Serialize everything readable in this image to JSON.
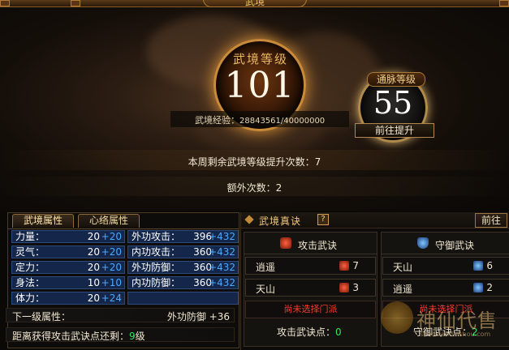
{
  "window": {
    "title": "武境"
  },
  "upper": {
    "main_orb": {
      "label": "武境等级",
      "value": "101"
    },
    "side_orb": {
      "label": "通脉等级",
      "value": "55"
    },
    "experience": {
      "label": "武境经验：",
      "value": "28843561/40000000"
    },
    "upgrade_button": "前往提升",
    "weekly_remaining": "本周剩余武境等级提升次数：7",
    "extra_count": "额外次数：2"
  },
  "left_panel": {
    "tabs": [
      {
        "label": "武境属性",
        "active": true
      },
      {
        "label": "心络属性",
        "active": false
      }
    ],
    "attributes": [
      {
        "label": "力量：",
        "base": "20",
        "bonus": "+20",
        "label2": "外功攻击：",
        "base2": "396",
        "bonus2": "+432"
      },
      {
        "label": "灵气：",
        "base": "20",
        "bonus": "+20",
        "label2": "内功攻击：",
        "base2": "360",
        "bonus2": "+432"
      },
      {
        "label": "定力：",
        "base": "20",
        "bonus": "+20",
        "label2": "外功防御：",
        "base2": "360",
        "bonus2": "+432"
      },
      {
        "label": "身法：",
        "base": "10",
        "bonus": "+10",
        "label2": "内功防御：",
        "base2": "360",
        "bonus2": "+432"
      },
      {
        "label": "体力：",
        "base": "20",
        "bonus": "+24",
        "label2": "",
        "base2": "",
        "bonus2": ""
      }
    ],
    "next_level": {
      "label": "下一级属性：",
      "value": "外功防御 +36"
    },
    "distance": {
      "prefix": "距离获得攻击武诀点还剩：",
      "value": "9",
      "suffix": "级"
    }
  },
  "right_panel": {
    "title": "武境真诀",
    "help": "?",
    "goto_button": "前往",
    "attack": {
      "title": "攻击武诀",
      "entries": [
        {
          "name": "逍遥",
          "value": "7"
        },
        {
          "name": "天山",
          "value": "3"
        }
      ],
      "notice": "尚未选择门派",
      "points_label": "攻击武诀点：",
      "points_value": "0"
    },
    "defense": {
      "title": "守御武诀",
      "entries": [
        {
          "name": "天山",
          "value": "6"
        },
        {
          "name": "逍遥",
          "value": "2"
        }
      ],
      "notice": "尚未选择门派",
      "points_label": "守御武诀点：",
      "points_value": "2"
    }
  },
  "watermark": {
    "text": "神仙代售",
    "sub": "shenxiandaishou.com"
  },
  "colors": {
    "accent_gold": "#e8b860",
    "bonus_blue": "#4aa8ff",
    "warning_red": "#ff3a2a",
    "points_green": "#30e860"
  }
}
